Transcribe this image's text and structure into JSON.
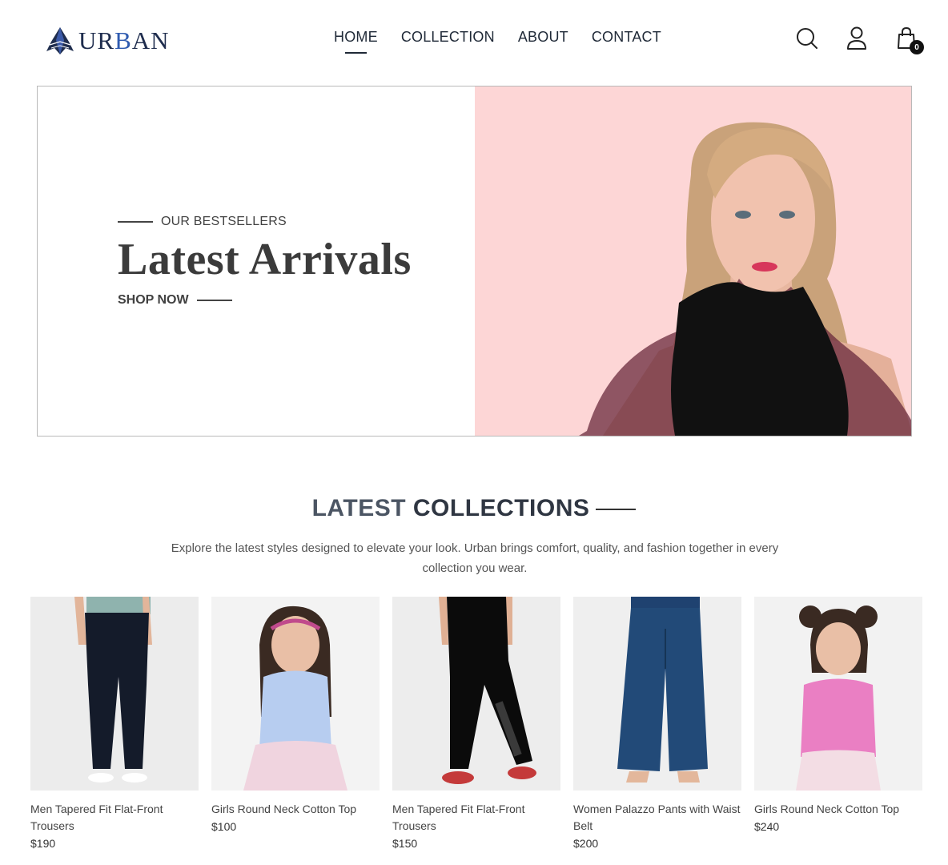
{
  "brand": {
    "name_prefix": "UR",
    "name_highlight": "B",
    "name_suffix": "AN",
    "accent": "#2f5bb0",
    "dark": "#1f2d4e"
  },
  "nav": {
    "links": [
      {
        "label": "HOME",
        "active": true
      },
      {
        "label": "COLLECTION",
        "active": false
      },
      {
        "label": "ABOUT",
        "active": false
      },
      {
        "label": "CONTACT",
        "active": false
      }
    ],
    "icons": [
      "search-icon",
      "user-icon",
      "cart-icon"
    ],
    "cart_count": "0"
  },
  "hero": {
    "eyebrow": "OUR BESTSELLERS",
    "title": "Latest Arrivals",
    "cta": "SHOP NOW",
    "bg_color": "#fdd6d6"
  },
  "collections": {
    "title_light": "LATEST ",
    "title_bold": "COLLECTIONS",
    "description": "Explore the latest styles designed to elevate your look. Urban brings comfort, quality, and fashion together in every collection you wear."
  },
  "products": [
    {
      "name": "Men Tapered Fit Flat-Front Trousers",
      "price": "$190"
    },
    {
      "name": "Girls Round Neck Cotton Top",
      "price": "$100"
    },
    {
      "name": "Men Tapered Fit Flat-Front Trousers",
      "price": "$150"
    },
    {
      "name": "Women Palazzo Pants with Waist Belt",
      "price": "$200"
    },
    {
      "name": "Girls Round Neck Cotton Top",
      "price": "$240"
    }
  ]
}
